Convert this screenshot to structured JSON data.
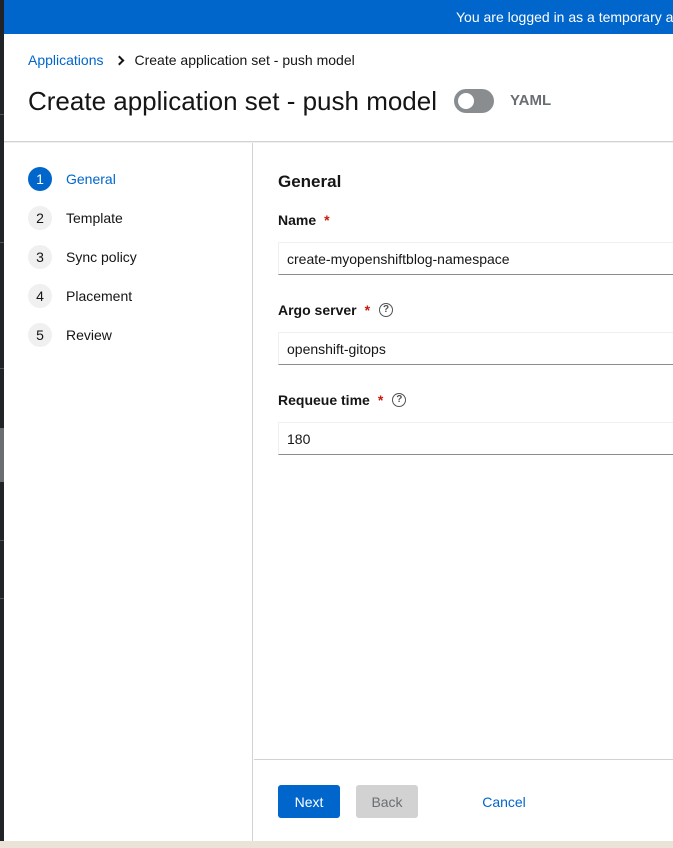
{
  "banner": {
    "text": "You are logged in as a temporary ad"
  },
  "breadcrumb": {
    "parent": "Applications",
    "current": "Create application set - push model"
  },
  "header": {
    "title": "Create application set - push model",
    "yaml_toggle_label": "YAML",
    "yaml_toggle_on": false
  },
  "wizard": {
    "steps": [
      {
        "number": "1",
        "label": "General"
      },
      {
        "number": "2",
        "label": "Template"
      },
      {
        "number": "3",
        "label": "Sync policy"
      },
      {
        "number": "4",
        "label": "Placement"
      },
      {
        "number": "5",
        "label": "Review"
      }
    ],
    "active_step": "General"
  },
  "form": {
    "section_title": "General",
    "name": {
      "label": "Name",
      "required_mark": "*",
      "value": "create-myopenshiftblog-namespace"
    },
    "argo_server": {
      "label": "Argo server",
      "required_mark": "*",
      "value": "openshift-gitops"
    },
    "requeue_time": {
      "label": "Requeue time",
      "required_mark": "*",
      "value": "180"
    }
  },
  "footer": {
    "next": "Next",
    "back": "Back",
    "cancel": "Cancel"
  },
  "colors": {
    "primary": "#0066cc",
    "required": "#c9190b",
    "banner": "#0066cc"
  }
}
